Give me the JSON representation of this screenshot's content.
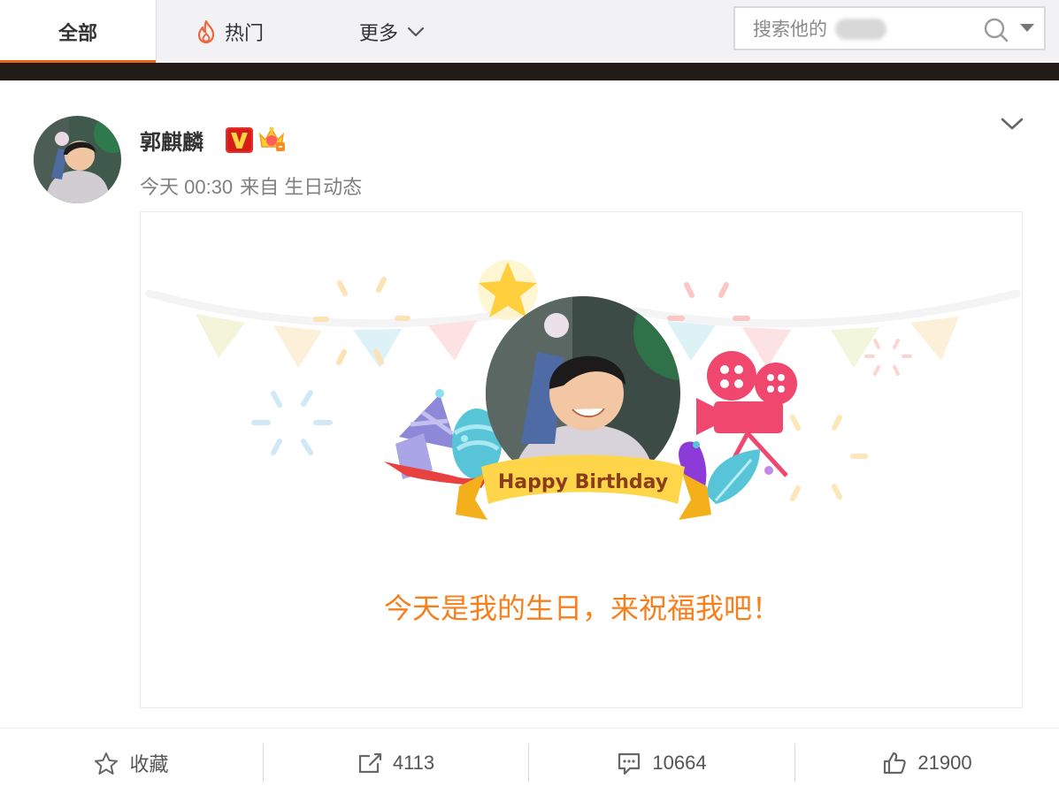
{
  "tabs": {
    "all": "全部",
    "hot": "热门",
    "more": "更多"
  },
  "search": {
    "placeholder": "搜索他的"
  },
  "post": {
    "author": "郭麒麟",
    "time": "今天 00:30",
    "source": "来自 生日动态"
  },
  "card": {
    "banner_text": "Happy Birthday",
    "message": "今天是我的生日，来祝福我吧！"
  },
  "actions": {
    "favorite": "收藏",
    "share_count": "4113",
    "comment_count": "10664",
    "like_count": "21900"
  },
  "colors": {
    "accent_orange": "#e8641b",
    "message_orange": "#f7801e",
    "dark_bar": "#231b15"
  },
  "icons": [
    "flame-icon",
    "chevron-down-icon",
    "search-icon",
    "caret-down-icon",
    "verified-v-icon",
    "crown-icon",
    "star-outline-icon",
    "share-icon",
    "comment-icon",
    "thumbs-up-icon"
  ]
}
